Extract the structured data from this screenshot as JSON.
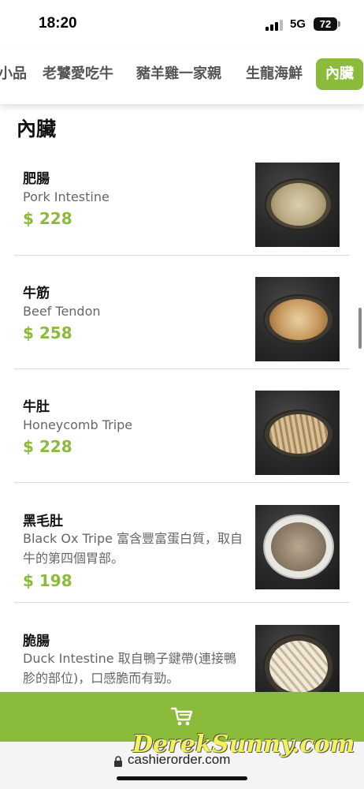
{
  "status_bar": {
    "time": "18:20",
    "network": "5G",
    "battery": "72"
  },
  "tabs": [
    {
      "label": "小品"
    },
    {
      "label": "老饕愛吃牛"
    },
    {
      "label": "豬羊雞一家親"
    },
    {
      "label": "生龍海鮮"
    },
    {
      "label": "內臟"
    }
  ],
  "active_tab": "內臟",
  "section": {
    "title": "內臟"
  },
  "items": [
    {
      "name": "肥腸",
      "desc": "Pork Intestine",
      "price": "$ 228"
    },
    {
      "name": "牛筋",
      "desc": "Beef Tendon",
      "price": "$ 258"
    },
    {
      "name": "牛肚",
      "desc": "Honeycomb Tripe",
      "price": "$ 228"
    },
    {
      "name": "黑毛肚",
      "desc": "Black Ox Tripe 富含豐富蛋白質，取自牛的第四個胃部。",
      "price": "$ 198"
    },
    {
      "name": "脆腸",
      "desc": "Duck Intestine 取自鴨子鍵帶(連接鴨胗的部位)，口感脆而有勁。",
      "price": ""
    }
  ],
  "cart": {
    "icon": "cart-icon"
  },
  "url_bar": {
    "url": "cashierorder.com"
  },
  "watermark": "DerekSunny.com",
  "colors": {
    "accent": "#8bbb3a",
    "text_primary": "#111111",
    "text_secondary": "#666666"
  }
}
